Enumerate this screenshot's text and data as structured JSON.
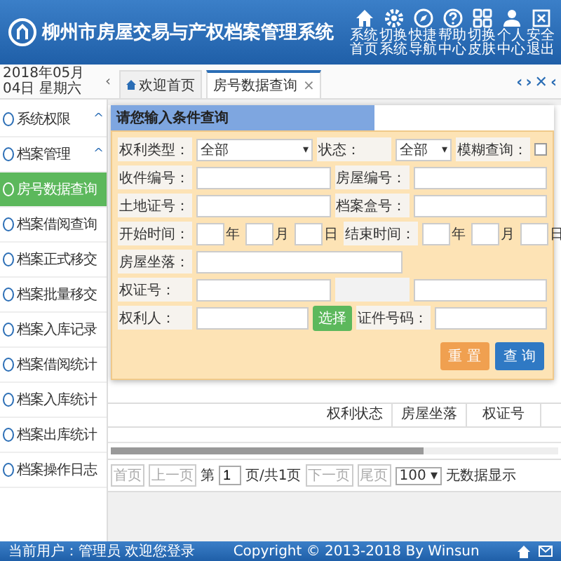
{
  "header": {
    "title": "柳州市房屋交易与产权档案管理系统",
    "actions": [
      {
        "label": "系统首页",
        "kind": "home"
      },
      {
        "label": "切换系统",
        "kind": "gear"
      },
      {
        "label": "快捷导航",
        "kind": "compass"
      },
      {
        "label": "帮助中心",
        "kind": "help"
      },
      {
        "label": "切换皮肤",
        "kind": "grid"
      },
      {
        "label": "个人中心",
        "kind": "user"
      },
      {
        "label": "安全退出",
        "kind": "exit"
      }
    ]
  },
  "tab_bar": {
    "date": "2018年05月04日 星期六",
    "collapse": "‹",
    "tabs": [
      {
        "label": "欢迎首页",
        "selected": false
      },
      {
        "label": "房号数据查询",
        "selected": true,
        "close": "×"
      }
    ],
    "controls": [
      "‹",
      "›",
      "✕",
      "‹"
    ]
  },
  "sidebar": {
    "items": [
      {
        "label": "系统权限",
        "kind": "group",
        "arrow": "^",
        "selected": false
      },
      {
        "label": "档案管理",
        "kind": "group",
        "arrow": "^",
        "selected": false
      },
      {
        "label": "房号数据查询",
        "kind": "item",
        "selected": true
      },
      {
        "label": "档案借阅查询",
        "kind": "item",
        "selected": false
      },
      {
        "label": "档案正式移交",
        "kind": "item",
        "selected": false
      },
      {
        "label": "档案批量移交",
        "kind": "item",
        "selected": false
      },
      {
        "label": "档案入库记录",
        "kind": "item",
        "selected": false
      },
      {
        "label": "档案借阅统计",
        "kind": "item",
        "selected": false
      },
      {
        "label": "档案入库统计",
        "kind": "item",
        "selected": false
      },
      {
        "label": "档案出库统计",
        "kind": "item",
        "selected": false
      },
      {
        "label": "档案操作日志",
        "kind": "item",
        "selected": false
      }
    ]
  },
  "table": {
    "columns": [
      "权利状态",
      "房屋坐落",
      "权证号"
    ]
  },
  "pagination": {
    "first": {
      "label": "首页",
      "disabled": true
    },
    "prev": {
      "label": "上一页",
      "disabled": true
    },
    "page_prefix": "第",
    "page": "1",
    "page_suffix": "页/共1页",
    "next": {
      "label": "下一页",
      "disabled": true
    },
    "last": {
      "label": "尾页",
      "disabled": true
    },
    "page_size": "100",
    "page_size_caret": "▾",
    "message": "无数据显示"
  },
  "search_dialog": {
    "title": "请您输入条件查询",
    "rows": [
      {
        "cells": [
          {
            "kind": "label",
            "text": "权利类型："
          },
          {
            "kind": "select",
            "value": "全部",
            "caret": "▾",
            "wide": true
          },
          {
            "kind": "label",
            "text": "状态："
          },
          {
            "kind": "select_group",
            "select": {
              "value": "全部",
              "caret": "▾"
            },
            "option": {
              "label": "模糊查询：",
              "checked": false
            }
          }
        ]
      },
      {
        "cells": [
          {
            "kind": "label",
            "text": "收件编号："
          },
          {
            "kind": "input"
          },
          {
            "kind": "label",
            "text": "房屋编号："
          },
          {
            "kind": "input"
          }
        ]
      },
      {
        "cells": [
          {
            "kind": "label",
            "text": "土地证号："
          },
          {
            "kind": "input"
          },
          {
            "kind": "label",
            "text": "档案盒号："
          },
          {
            "kind": "input"
          }
        ]
      },
      {
        "cells": [
          {
            "kind": "label",
            "text": "开始时间："
          },
          {
            "kind": "date",
            "units": [
              "年",
              "月",
              "日"
            ]
          },
          {
            "kind": "label",
            "text": "结束时间："
          },
          {
            "kind": "date",
            "units": [
              "年",
              "月",
              "日"
            ]
          }
        ]
      },
      {
        "cells": [
          {
            "kind": "label",
            "text": "房屋坐落："
          },
          {
            "kind": "input"
          },
          {
            "kind": "spacer"
          }
        ]
      },
      {
        "cells": [
          {
            "kind": "label",
            "text": "权证号："
          },
          {
            "kind": "input"
          },
          {
            "kind": "blank"
          },
          {
            "kind": "input"
          }
        ]
      },
      {
        "cells": [
          {
            "kind": "label",
            "text": "权利人："
          },
          {
            "kind": "input"
          },
          {
            "kind": "button",
            "label": "选择"
          },
          {
            "kind": "label",
            "text": "证件号码："
          },
          {
            "kind": "input"
          }
        ]
      }
    ],
    "buttons": [
      {
        "label": "重 置",
        "kind": "reset"
      },
      {
        "label": "查 询",
        "kind": "search"
      }
    ]
  },
  "footer": {
    "left": "当前用户：管理员 欢迎您登录",
    "copyright": "Copyright © 2013-2018 By Winsun"
  }
}
